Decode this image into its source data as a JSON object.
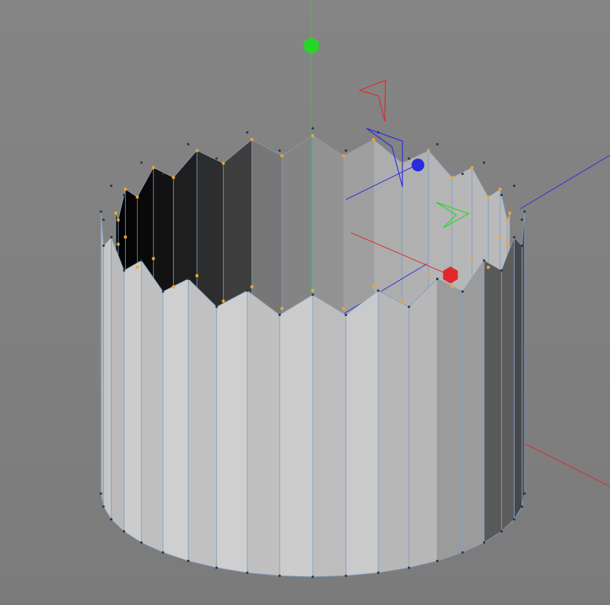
{
  "viewport": {
    "background": "#7b7b7b",
    "background_top": "#858585",
    "wireframe_color": "#7f9fc4",
    "selected_point_color": "#f2a531",
    "unselected_point_color": "#2a3340"
  },
  "object": {
    "type": "cylinder",
    "segments": 40,
    "wall": "zigzag-pleated",
    "selection_mode": "points",
    "selected_ring": "top-inner"
  },
  "gizmo": {
    "x_axis_color": "#e02828",
    "y_axis_color": "#26d626",
    "z_axis_color": "#2a2ae0",
    "handles": [
      {
        "axis": "y",
        "icon": "hexagon-handle-icon"
      },
      {
        "axis": "x",
        "icon": "hexagon-handle-icon"
      },
      {
        "axis": "z",
        "icon": "sphere-handle-icon"
      }
    ]
  }
}
